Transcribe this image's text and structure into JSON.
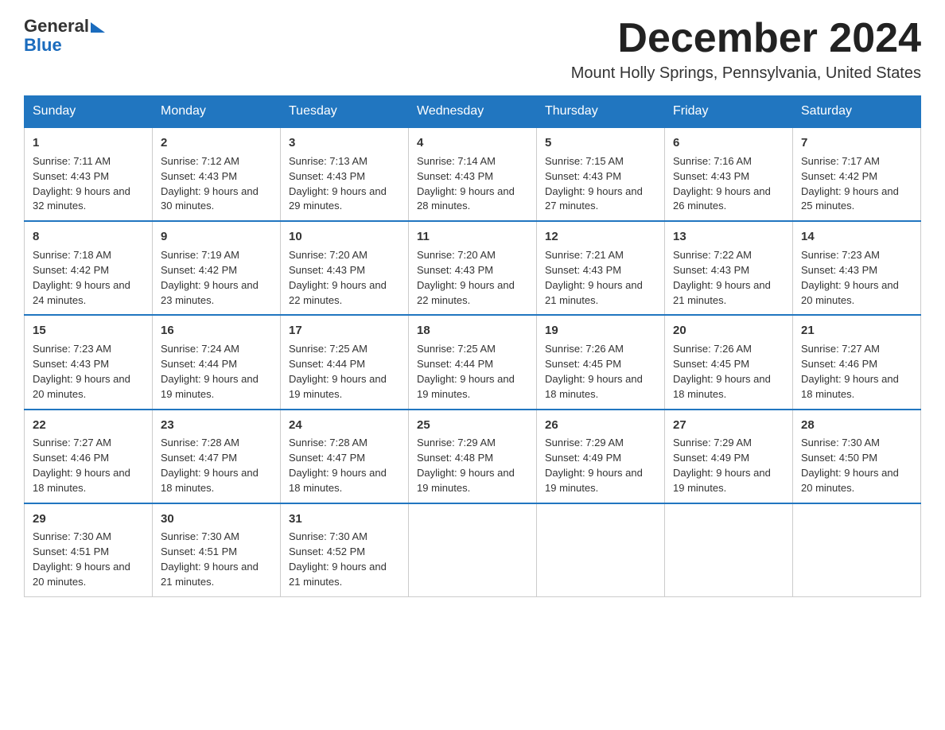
{
  "header": {
    "month_title": "December 2024",
    "location": "Mount Holly Springs, Pennsylvania, United States"
  },
  "logo": {
    "line1": "General",
    "line2": "Blue"
  },
  "days_of_week": [
    "Sunday",
    "Monday",
    "Tuesday",
    "Wednesday",
    "Thursday",
    "Friday",
    "Saturday"
  ],
  "weeks": [
    [
      {
        "day": "1",
        "sunrise": "7:11 AM",
        "sunset": "4:43 PM",
        "daylight": "9 hours and 32 minutes."
      },
      {
        "day": "2",
        "sunrise": "7:12 AM",
        "sunset": "4:43 PM",
        "daylight": "9 hours and 30 minutes."
      },
      {
        "day": "3",
        "sunrise": "7:13 AM",
        "sunset": "4:43 PM",
        "daylight": "9 hours and 29 minutes."
      },
      {
        "day": "4",
        "sunrise": "7:14 AM",
        "sunset": "4:43 PM",
        "daylight": "9 hours and 28 minutes."
      },
      {
        "day": "5",
        "sunrise": "7:15 AM",
        "sunset": "4:43 PM",
        "daylight": "9 hours and 27 minutes."
      },
      {
        "day": "6",
        "sunrise": "7:16 AM",
        "sunset": "4:43 PM",
        "daylight": "9 hours and 26 minutes."
      },
      {
        "day": "7",
        "sunrise": "7:17 AM",
        "sunset": "4:42 PM",
        "daylight": "9 hours and 25 minutes."
      }
    ],
    [
      {
        "day": "8",
        "sunrise": "7:18 AM",
        "sunset": "4:42 PM",
        "daylight": "9 hours and 24 minutes."
      },
      {
        "day": "9",
        "sunrise": "7:19 AM",
        "sunset": "4:42 PM",
        "daylight": "9 hours and 23 minutes."
      },
      {
        "day": "10",
        "sunrise": "7:20 AM",
        "sunset": "4:43 PM",
        "daylight": "9 hours and 22 minutes."
      },
      {
        "day": "11",
        "sunrise": "7:20 AM",
        "sunset": "4:43 PM",
        "daylight": "9 hours and 22 minutes."
      },
      {
        "day": "12",
        "sunrise": "7:21 AM",
        "sunset": "4:43 PM",
        "daylight": "9 hours and 21 minutes."
      },
      {
        "day": "13",
        "sunrise": "7:22 AM",
        "sunset": "4:43 PM",
        "daylight": "9 hours and 21 minutes."
      },
      {
        "day": "14",
        "sunrise": "7:23 AM",
        "sunset": "4:43 PM",
        "daylight": "9 hours and 20 minutes."
      }
    ],
    [
      {
        "day": "15",
        "sunrise": "7:23 AM",
        "sunset": "4:43 PM",
        "daylight": "9 hours and 20 minutes."
      },
      {
        "day": "16",
        "sunrise": "7:24 AM",
        "sunset": "4:44 PM",
        "daylight": "9 hours and 19 minutes."
      },
      {
        "day": "17",
        "sunrise": "7:25 AM",
        "sunset": "4:44 PM",
        "daylight": "9 hours and 19 minutes."
      },
      {
        "day": "18",
        "sunrise": "7:25 AM",
        "sunset": "4:44 PM",
        "daylight": "9 hours and 19 minutes."
      },
      {
        "day": "19",
        "sunrise": "7:26 AM",
        "sunset": "4:45 PM",
        "daylight": "9 hours and 18 minutes."
      },
      {
        "day": "20",
        "sunrise": "7:26 AM",
        "sunset": "4:45 PM",
        "daylight": "9 hours and 18 minutes."
      },
      {
        "day": "21",
        "sunrise": "7:27 AM",
        "sunset": "4:46 PM",
        "daylight": "9 hours and 18 minutes."
      }
    ],
    [
      {
        "day": "22",
        "sunrise": "7:27 AM",
        "sunset": "4:46 PM",
        "daylight": "9 hours and 18 minutes."
      },
      {
        "day": "23",
        "sunrise": "7:28 AM",
        "sunset": "4:47 PM",
        "daylight": "9 hours and 18 minutes."
      },
      {
        "day": "24",
        "sunrise": "7:28 AM",
        "sunset": "4:47 PM",
        "daylight": "9 hours and 18 minutes."
      },
      {
        "day": "25",
        "sunrise": "7:29 AM",
        "sunset": "4:48 PM",
        "daylight": "9 hours and 19 minutes."
      },
      {
        "day": "26",
        "sunrise": "7:29 AM",
        "sunset": "4:49 PM",
        "daylight": "9 hours and 19 minutes."
      },
      {
        "day": "27",
        "sunrise": "7:29 AM",
        "sunset": "4:49 PM",
        "daylight": "9 hours and 19 minutes."
      },
      {
        "day": "28",
        "sunrise": "7:30 AM",
        "sunset": "4:50 PM",
        "daylight": "9 hours and 20 minutes."
      }
    ],
    [
      {
        "day": "29",
        "sunrise": "7:30 AM",
        "sunset": "4:51 PM",
        "daylight": "9 hours and 20 minutes."
      },
      {
        "day": "30",
        "sunrise": "7:30 AM",
        "sunset": "4:51 PM",
        "daylight": "9 hours and 21 minutes."
      },
      {
        "day": "31",
        "sunrise": "7:30 AM",
        "sunset": "4:52 PM",
        "daylight": "9 hours and 21 minutes."
      },
      null,
      null,
      null,
      null
    ]
  ]
}
